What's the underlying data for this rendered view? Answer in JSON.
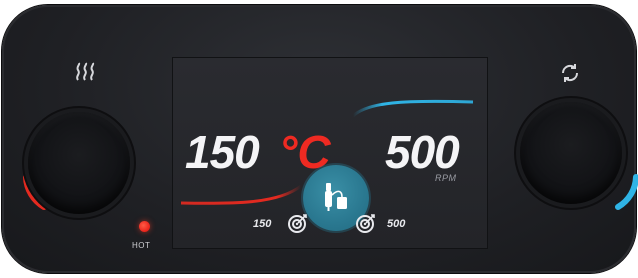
{
  "display": {
    "temperature": {
      "value": "150",
      "unit": "°C",
      "setpoint": "150"
    },
    "speed": {
      "value": "500",
      "unit": "RPM",
      "setpoint": "500"
    }
  },
  "indicators": {
    "hot_label": "HOT"
  },
  "icons": {
    "heat": "heat-waves-icon",
    "rotate": "rotation-icon",
    "center": "probe-sensor-icon",
    "target": "target-icon"
  },
  "colors": {
    "panel": "#1f2024",
    "screen": "#26272b",
    "heat_accent": "#ee2a22",
    "speed_accent": "#2fb4e6",
    "badge": "#2a7890"
  }
}
